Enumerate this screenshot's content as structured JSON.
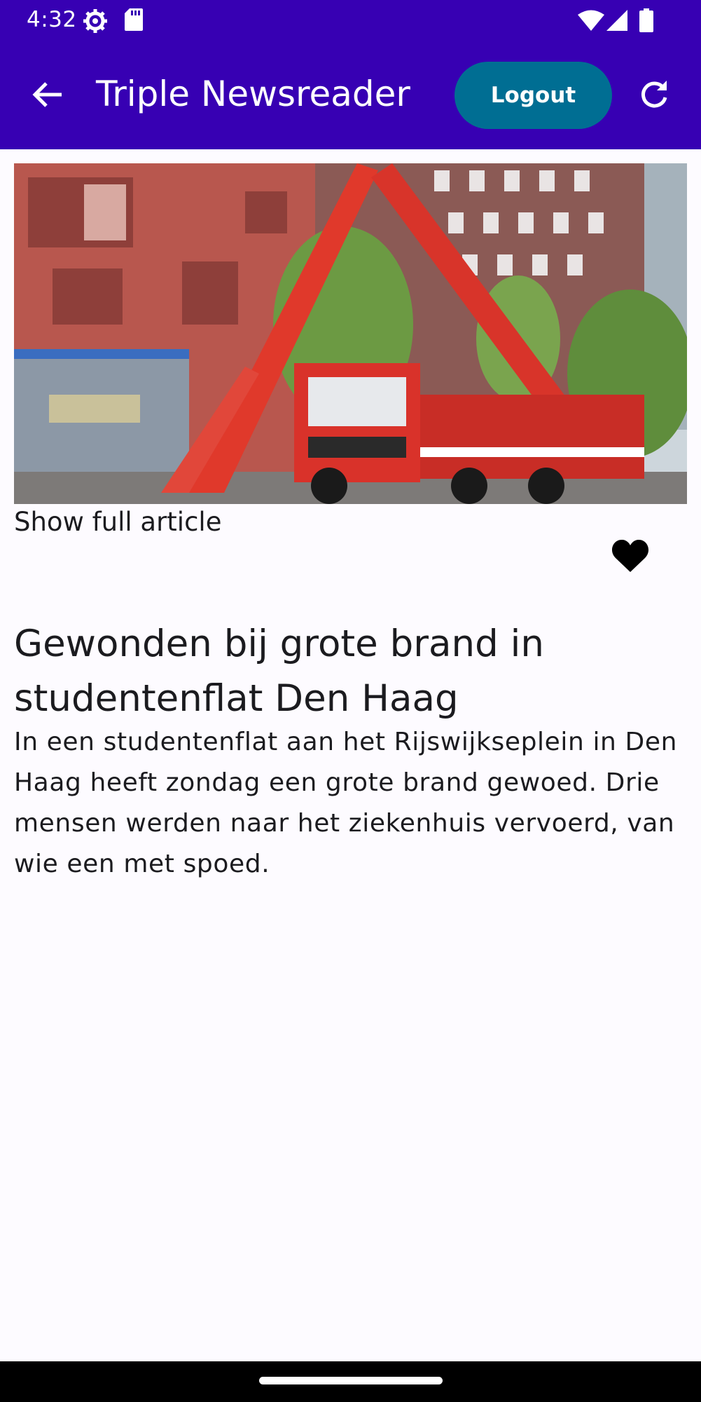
{
  "status_bar": {
    "time": "4:32",
    "icons": [
      "settings-icon",
      "sd-card-icon",
      "wifi-icon",
      "signal-icon",
      "battery-icon"
    ]
  },
  "app_bar": {
    "back_icon": "arrow-left-icon",
    "title": "Triple Newsreader",
    "logout_label": "Logout",
    "refresh_icon": "refresh-icon",
    "color": "#3700b3",
    "button_color": "#006e93"
  },
  "article": {
    "image_icon": "fire-truck-photo",
    "show_full_label": "Show full article",
    "favorite_icon": "heart-icon",
    "favorite_active": true,
    "title": "Gewonden bij grote brand in studentenflat Den Haag",
    "summary": "In een studentenflat aan het Rijswijkseplein in Den Haag heeft zondag een grote brand gewoed. Drie mensen werden naar het ziekenhuis vervoerd, van wie een met spoed."
  }
}
